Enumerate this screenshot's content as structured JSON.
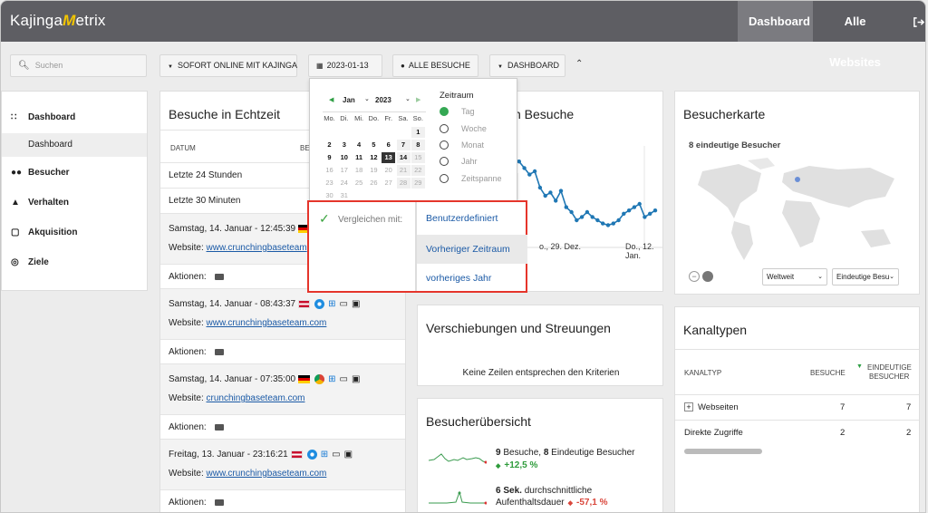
{
  "app": {
    "logo_prefix": "Kajinga",
    "logo_m": "M",
    "logo_suffix": "etrix"
  },
  "topnav": {
    "dashboard": "Dashboard",
    "sites": "Alle Websites",
    "logout_icon": "logout-icon"
  },
  "toolbar": {
    "search_placeholder": "Suchen",
    "online": "SOFORT ONLINE MIT KAJINGA",
    "date": "2023-01-13",
    "segment": "ALLE BESUCHE",
    "dashboard": "DASHBOARD",
    "collapse_icon": "chevron-up-icon"
  },
  "sidebar": {
    "items": [
      {
        "label": "Dashboard",
        "icon": "grid-icon"
      },
      {
        "label": "Dashboard"
      },
      {
        "label": "Besucher",
        "icon": "binoculars-icon"
      },
      {
        "label": "Verhalten",
        "icon": "bell-icon"
      },
      {
        "label": "Akquisition",
        "icon": "calendar-icon"
      },
      {
        "label": "Ziele",
        "icon": "target-icon"
      }
    ]
  },
  "realtime": {
    "title": "Besuche in Echtzeit",
    "col_date": "DATUM",
    "col_visits": "BE",
    "rows": [
      "Letzte 24 Stunden",
      "Letzte 30 Minuten"
    ],
    "visits": [
      {
        "time": "Samstag, 14. Januar - 12:45:39",
        "flag": "de",
        "site_label": "Website:",
        "site": "www.crunchingbaseteam",
        "actions": "Aktionen:"
      },
      {
        "time": "Samstag, 14. Januar - 08:43:37",
        "flag": "at",
        "site_label": "Website:",
        "site": "www.crunchingbaseteam.com",
        "actions": "Aktionen:"
      },
      {
        "time": "Samstag, 14. Januar - 07:35:00",
        "flag": "de",
        "site_label": "Website:",
        "site": "crunchingbaseteam.com",
        "actions": "Aktionen:"
      },
      {
        "time": "Freitag, 13. Januar - 23:16:21",
        "flag": "at",
        "site_label": "Website:",
        "site": "www.crunchingbaseteam.com",
        "actions": "Aktionen:"
      }
    ]
  },
  "visits_card": {
    "title_rest": "n Besuche",
    "x_labels": [
      "o., 29. Dez.",
      "Do., 12. Jan."
    ],
    "points": [
      48,
      46,
      42,
      38,
      40,
      30,
      25,
      27,
      22,
      28,
      18,
      15,
      10,
      12,
      15,
      12,
      10,
      8,
      7,
      8,
      10,
      14,
      16,
      18,
      20,
      12,
      14,
      16
    ]
  },
  "map": {
    "title": "Besucherkarte",
    "subtitle": "8 eindeutige Besucher",
    "region": "Weltweit",
    "metric": "Eindeutige Besu"
  },
  "shift": {
    "title": "Verschiebungen und Streuungen",
    "empty": "Keine Zeilen entsprechen den Kriterien"
  },
  "overview": {
    "title": "Besucherübersicht",
    "line1_a": "9",
    "line1_b": " Besuche, ",
    "line1_c": "8",
    "line1_d": " Eindeutige Besucher",
    "line1_change": "+12,5 %",
    "line2_a": "6 Sek.",
    "line2_b": " durchschnittliche",
    "line2_c": "Aufenthaltsdauer",
    "line2_change": "-57,1 %"
  },
  "channels": {
    "title": "Kanaltypen",
    "col_type": "KANALTYP",
    "col_visits": "BESUCHE",
    "col_unique_1": "EINDEUTIGE",
    "col_unique_2": "BESUCHER",
    "rows": [
      {
        "name": "Webseiten",
        "visits": "7",
        "unique": "7"
      },
      {
        "name": "Direkte Zugriffe",
        "visits": "2",
        "unique": "2"
      }
    ]
  },
  "datepicker": {
    "month": "Jan",
    "year": "2023",
    "weekdays": [
      "Mo.",
      "Di.",
      "Mi.",
      "Do.",
      "Fr.",
      "Sa.",
      "So."
    ],
    "weeks": [
      [
        "",
        "",
        "",
        "",
        "",
        "",
        "1"
      ],
      [
        "2",
        "3",
        "4",
        "5",
        "6",
        "7",
        "8"
      ],
      [
        "9",
        "10",
        "11",
        "12",
        "13",
        "14",
        "15"
      ],
      [
        "16",
        "17",
        "18",
        "19",
        "20",
        "21",
        "22"
      ],
      [
        "23",
        "24",
        "25",
        "26",
        "27",
        "28",
        "29"
      ],
      [
        "30",
        "31",
        "",
        "",
        "",
        "",
        ""
      ]
    ],
    "selected": "13",
    "period_title": "Zeitraum",
    "periods": [
      "Tag",
      "Woche",
      "Monat",
      "Jahr",
      "Zeitspanne"
    ],
    "selected_period": "Tag"
  },
  "compare": {
    "label": "Vergleichen mit:",
    "options": [
      "Benutzerdefiniert",
      "Vorheriger Zeitraum",
      "vorheriges Jahr"
    ],
    "highlight_color": "#e5352b"
  }
}
